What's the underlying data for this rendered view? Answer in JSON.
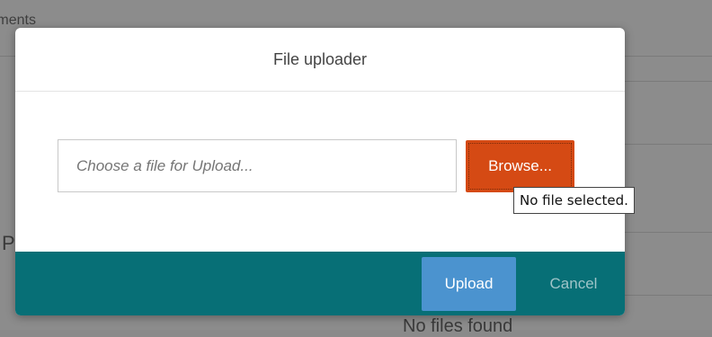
{
  "background": {
    "section_title": "Documents",
    "partial_heading": "P",
    "empty_state": "No files found"
  },
  "modal": {
    "title": "File uploader",
    "file_input": {
      "placeholder": "Choose a file for Upload...",
      "value": ""
    },
    "browse_label": "Browse...",
    "tooltip": "No file selected.",
    "upload_label": "Upload",
    "cancel_label": "Cancel"
  },
  "colors": {
    "browse_button": "#d54a14",
    "footer": "#076f76",
    "upload_button": "#4b93cf"
  }
}
